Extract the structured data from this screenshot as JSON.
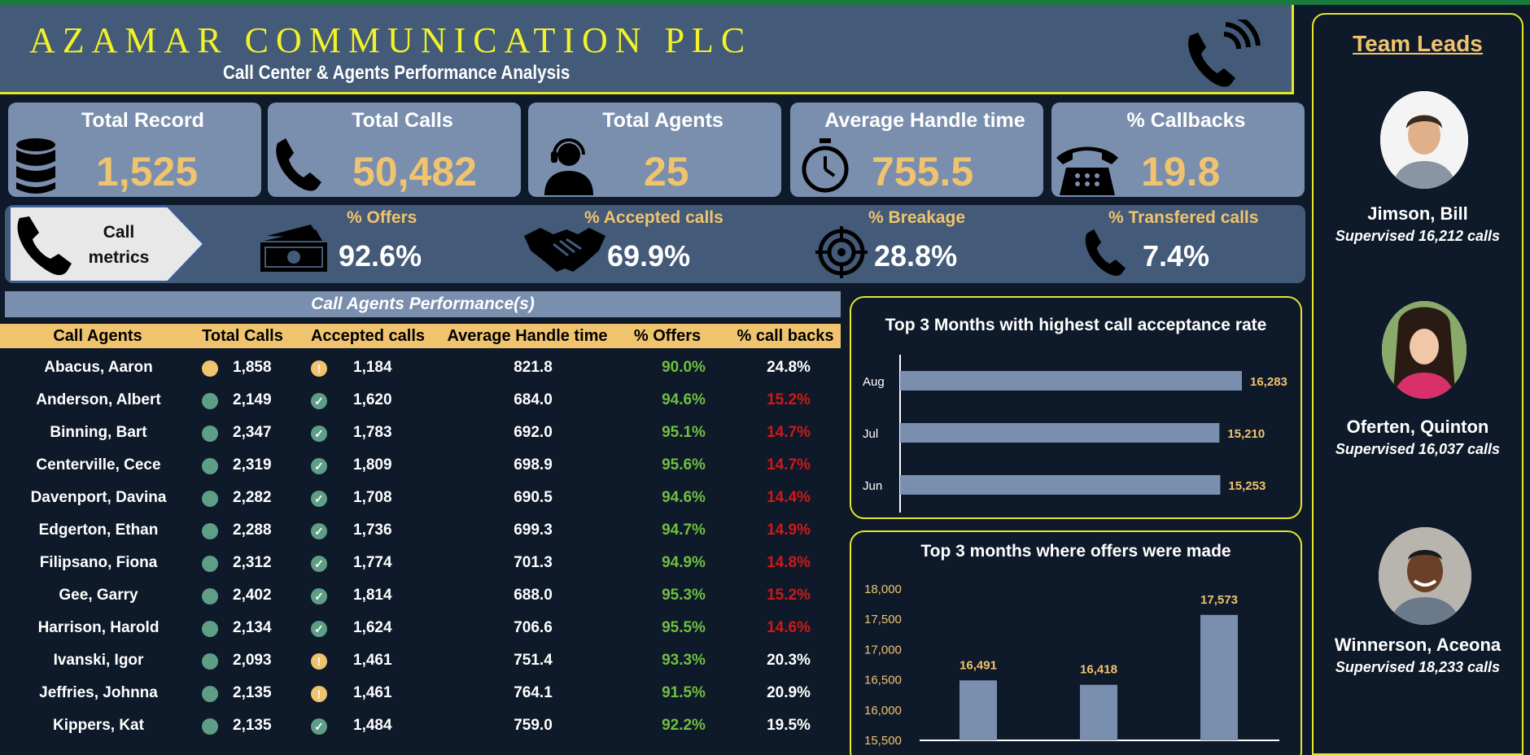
{
  "header": {
    "company": "AZAMAR COMMUNICATION PLC",
    "subtitle": "Call Center & Agents Performance Analysis"
  },
  "kpis": [
    {
      "title": "Total Record",
      "value": "1,525",
      "icon": "database-icon"
    },
    {
      "title": "Total Calls",
      "value": "50,482",
      "icon": "phone-icon"
    },
    {
      "title": "Total Agents",
      "value": "25",
      "icon": "headset-agent-icon"
    },
    {
      "title": "Average Handle time",
      "value": "755.5",
      "icon": "stopwatch-icon"
    },
    {
      "title": "% Callbacks",
      "value": "19.8",
      "icon": "desk-phone-icon"
    }
  ],
  "metrics": {
    "label": "Call metrics",
    "items": [
      {
        "title": "% Offers",
        "value": "92.6%",
        "icon": "money-icon"
      },
      {
        "title": "% Accepted calls",
        "value": "69.9%",
        "icon": "handshake-icon"
      },
      {
        "title": "% Breakage",
        "value": "28.8%",
        "icon": "target-icon"
      },
      {
        "title": "% Transfered calls",
        "value": "7.4%",
        "icon": "phone-icon"
      }
    ]
  },
  "table": {
    "title": "Call Agents Performance(s)",
    "columns": [
      "Call Agents",
      "Total Calls",
      "Accepted calls",
      "Average Handle time",
      "% Offers",
      "% call backs"
    ],
    "rows": [
      {
        "agent": "Abacus, Aaron",
        "calls": "1,858",
        "calls_status": "warn",
        "accepted": "1,184",
        "accepted_status": "warn",
        "aht": "821.8",
        "offers": "90.0%",
        "callbacks": "24.8%",
        "callbacks_status": "ok"
      },
      {
        "agent": "Anderson, Albert",
        "calls": "2,149",
        "calls_status": "good",
        "accepted": "1,620",
        "accepted_status": "good",
        "aht": "684.0",
        "offers": "94.6%",
        "callbacks": "15.2%",
        "callbacks_status": "bad"
      },
      {
        "agent": "Binning, Bart",
        "calls": "2,347",
        "calls_status": "good",
        "accepted": "1,783",
        "accepted_status": "good",
        "aht": "692.0",
        "offers": "95.1%",
        "callbacks": "14.7%",
        "callbacks_status": "bad"
      },
      {
        "agent": "Centerville, Cece",
        "calls": "2,319",
        "calls_status": "good",
        "accepted": "1,809",
        "accepted_status": "good",
        "aht": "698.9",
        "offers": "95.6%",
        "callbacks": "14.7%",
        "callbacks_status": "bad"
      },
      {
        "agent": "Davenport, Davina",
        "calls": "2,282",
        "calls_status": "good",
        "accepted": "1,708",
        "accepted_status": "good",
        "aht": "690.5",
        "offers": "94.6%",
        "callbacks": "14.4%",
        "callbacks_status": "bad"
      },
      {
        "agent": "Edgerton, Ethan",
        "calls": "2,288",
        "calls_status": "good",
        "accepted": "1,736",
        "accepted_status": "good",
        "aht": "699.3",
        "offers": "94.7%",
        "callbacks": "14.9%",
        "callbacks_status": "bad"
      },
      {
        "agent": "Filipsano, Fiona",
        "calls": "2,312",
        "calls_status": "good",
        "accepted": "1,774",
        "accepted_status": "good",
        "aht": "701.3",
        "offers": "94.9%",
        "callbacks": "14.8%",
        "callbacks_status": "bad"
      },
      {
        "agent": "Gee, Garry",
        "calls": "2,402",
        "calls_status": "good",
        "accepted": "1,814",
        "accepted_status": "good",
        "aht": "688.0",
        "offers": "95.3%",
        "callbacks": "15.2%",
        "callbacks_status": "bad"
      },
      {
        "agent": "Harrison, Harold",
        "calls": "2,134",
        "calls_status": "good",
        "accepted": "1,624",
        "accepted_status": "good",
        "aht": "706.6",
        "offers": "95.5%",
        "callbacks": "14.6%",
        "callbacks_status": "bad"
      },
      {
        "agent": "Ivanski, Igor",
        "calls": "2,093",
        "calls_status": "good",
        "accepted": "1,461",
        "accepted_status": "warn",
        "aht": "751.4",
        "offers": "93.3%",
        "callbacks": "20.3%",
        "callbacks_status": "ok"
      },
      {
        "agent": "Jeffries, Johnna",
        "calls": "2,135",
        "calls_status": "good",
        "accepted": "1,461",
        "accepted_status": "warn",
        "aht": "764.1",
        "offers": "91.5%",
        "callbacks": "20.9%",
        "callbacks_status": "ok"
      },
      {
        "agent": "Kippers, Kat",
        "calls": "2,135",
        "calls_status": "good",
        "accepted": "1,484",
        "accepted_status": "good",
        "aht": "759.0",
        "offers": "92.2%",
        "callbacks": "19.5%",
        "callbacks_status": "ok"
      }
    ]
  },
  "colors": {
    "accent": "#f0c46e",
    "panel": "#435a78",
    "bar": "#7a8eae",
    "good_dot": "#5e9e86",
    "warn_dot": "#f0c46e",
    "offers_green": "#6fbf3f",
    "callback_red": "#d01818",
    "border_yellow": "#e6e62a"
  },
  "chart_data": [
    {
      "type": "bar",
      "orientation": "horizontal",
      "title": "Top 3 Months with highest call acceptance rate",
      "categories": [
        "Aug",
        "Jul",
        "Jun"
      ],
      "values": [
        16283,
        15210,
        15253
      ],
      "labels": [
        "16,283",
        "15,210",
        "15,253"
      ],
      "xlim": [
        0,
        16283
      ],
      "grid": false
    },
    {
      "type": "bar",
      "title": "Top 3 months where offers were made",
      "categories": [
        "",
        "",
        ""
      ],
      "values": [
        16491,
        16418,
        17573
      ],
      "labels": [
        "16,491",
        "16,418",
        "17,573"
      ],
      "ylim": [
        15500,
        18000
      ],
      "yticks": [
        "18,000",
        "17,500",
        "17,000",
        "16,500",
        "16,000",
        "15,500"
      ],
      "grid": false
    }
  ],
  "leads": {
    "title": "Team Leads",
    "items": [
      {
        "name": "Jimson, Bill",
        "sub": "Supervised 16,212 calls"
      },
      {
        "name": "Oferten, Quinton",
        "sub": "Supervised 16,037 calls"
      },
      {
        "name": "Winnerson, Aceona",
        "sub": "Supervised 18,233 calls"
      }
    ]
  }
}
